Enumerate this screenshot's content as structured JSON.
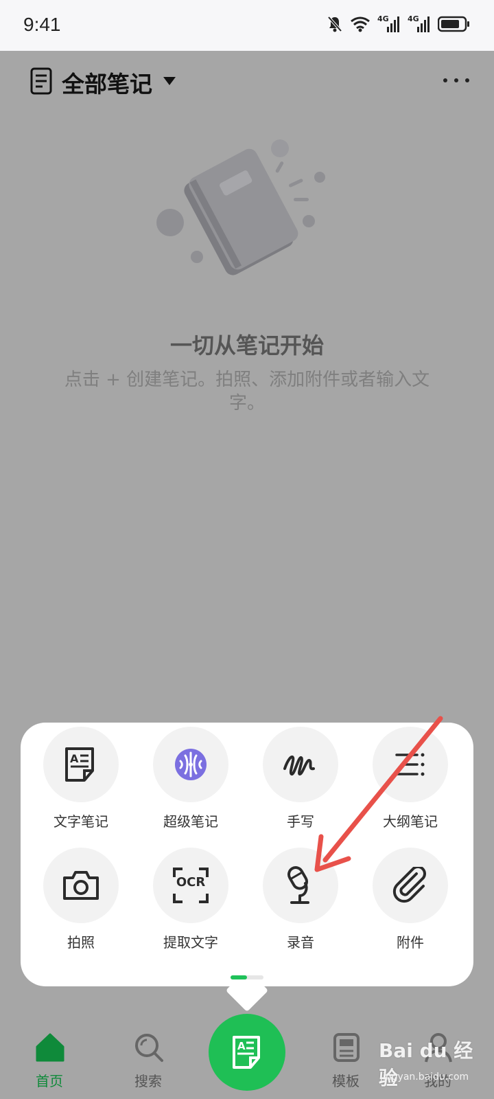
{
  "status": {
    "time": "9:41",
    "signal1": "4G",
    "signal2": "4G"
  },
  "header": {
    "title": "全部笔记"
  },
  "empty": {
    "title": "一切从笔记开始",
    "subtitle": "点击 + 创建笔记。拍照、添加附件或者输入文字。"
  },
  "menu": {
    "items": [
      {
        "label": "文字笔记",
        "icon": "text-note-icon"
      },
      {
        "label": "超级笔记",
        "icon": "super-note-icon"
      },
      {
        "label": "手写",
        "icon": "handwriting-icon"
      },
      {
        "label": "大纲笔记",
        "icon": "outline-note-icon"
      },
      {
        "label": "拍照",
        "icon": "camera-icon"
      },
      {
        "label": "提取文字",
        "icon": "ocr-icon",
        "icon_text": "OCR"
      },
      {
        "label": "录音",
        "icon": "microphone-icon"
      },
      {
        "label": "附件",
        "icon": "paperclip-icon"
      }
    ],
    "page": 1,
    "pages": 2
  },
  "tabs": [
    {
      "label": "首页",
      "icon": "home-icon",
      "active": true
    },
    {
      "label": "搜索",
      "icon": "search-icon",
      "active": false
    },
    {
      "label": "模板",
      "icon": "template-icon",
      "active": false
    },
    {
      "label": "我的",
      "icon": "profile-icon",
      "active": false
    }
  ],
  "colors": {
    "accent": "#1fbf55",
    "overlay": "#a6a6a6",
    "annotation_arrow": "#e8514a"
  },
  "watermark": {
    "text": "Bai du 经验",
    "url": "jingyan.baidu.com"
  }
}
